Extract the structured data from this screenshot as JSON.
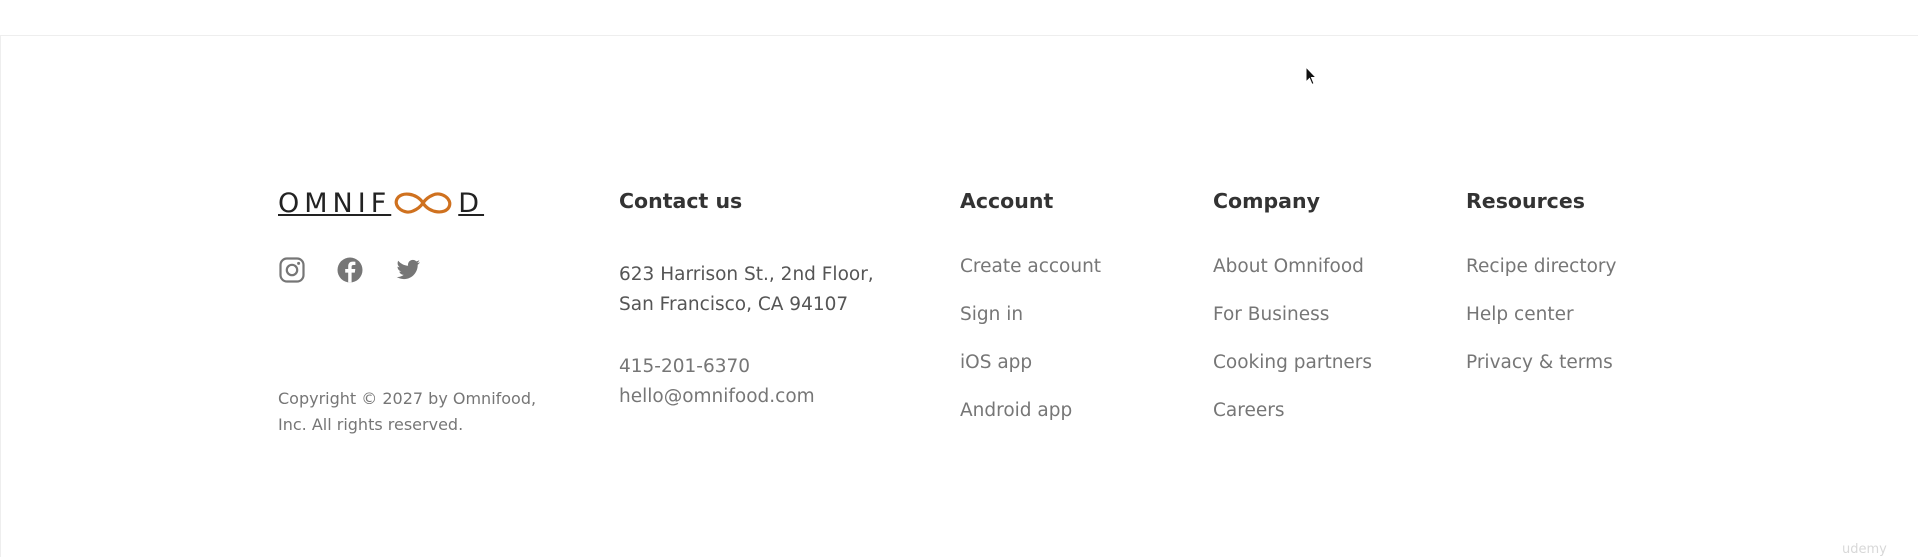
{
  "logo": {
    "text_before": "OMNIF",
    "text_after": "D",
    "accent_color": "#cf711f"
  },
  "social": [
    {
      "icon": "instagram-icon"
    },
    {
      "icon": "facebook-icon"
    },
    {
      "icon": "twitter-icon"
    }
  ],
  "copyright": "Copyright © 2027 by Omnifood, Inc. All rights reserved.",
  "contact": {
    "heading": "Contact us",
    "address_line1": "623 Harrison St., 2nd Floor,",
    "address_line2": "San Francisco, CA 94107",
    "phone": "415-201-6370",
    "email": "hello@omnifood.com"
  },
  "account": {
    "heading": "Account",
    "links": [
      "Create account",
      "Sign in",
      "iOS app",
      "Android app"
    ]
  },
  "company": {
    "heading": "Company",
    "links": [
      "About Omnifood",
      "For Business",
      "Cooking partners",
      "Careers"
    ]
  },
  "resources": {
    "heading": "Resources",
    "links": [
      "Recipe directory",
      "Help center",
      "Privacy & terms"
    ]
  },
  "watermark": "udemy"
}
